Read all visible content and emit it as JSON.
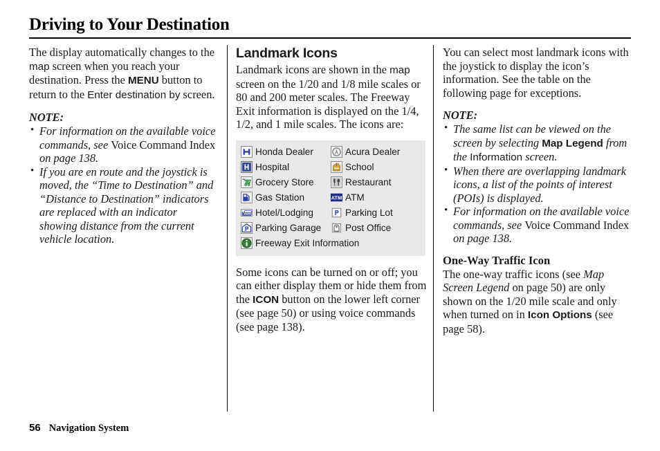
{
  "document": {
    "title": "Driving to Your Destination",
    "footer": {
      "page_number": "56",
      "section": "Navigation System"
    }
  },
  "colors": {
    "table_background": "#e9e9e9",
    "honda_blue": "#2a3fa8",
    "hospital_blue": "#2a3fa8",
    "grocery_green": "#1f7a33",
    "gas_blue": "#2a3fa8",
    "hotel_blue": "#3a4fb0",
    "parking_blue": "#2a3fa8",
    "atm_blue": "#23309a",
    "school_tan": "#d9a33c",
    "restaurant_gray": "#8c8c8c",
    "freeway_green": "#2e7d32",
    "acura_gray": "#9a9a9a",
    "postoffice_gray": "#7a7a7a",
    "text": "#1a1a1a"
  },
  "column_left": {
    "intro": {
      "s1": "The display automatically changes to the ",
      "screen_word_1": "map",
      "s2": " screen when you reach your destination. Press the ",
      "button_word": "MENU",
      "s3": " button to return to the ",
      "screen_word_2": "Enter destination by",
      "s4": " screen."
    },
    "note_label": "NOTE:",
    "notes": [
      {
        "a": "For information on the available voice commands, see ",
        "b": "Voice Command Index",
        "c": " on page 138."
      },
      {
        "a": "If you are en route and the joystick is moved, the “Time to Destination” and “Distance to Destination” indicators are replaced with an indicator showing distance from the current vehicle location.",
        "b": "",
        "c": ""
      }
    ]
  },
  "column_middle": {
    "heading": "Landmark Icons",
    "intro": {
      "s1": "Landmark icons are shown in the ",
      "screen_word": "map",
      "s2": " screen on the 1/20 and 1/8 mile scales or 80 and 200 meter scales. The Freeway Exit information is displayed on the 1/4, 1/2, and 1 mile scales. The icons are:"
    },
    "icon_table": {
      "rows": [
        [
          {
            "icon": "honda-dealer-icon",
            "label": "Honda Dealer"
          },
          {
            "icon": "acura-dealer-icon",
            "label": "Acura Dealer"
          }
        ],
        [
          {
            "icon": "hospital-icon",
            "label": "Hospital"
          },
          {
            "icon": "school-icon",
            "label": "School"
          }
        ],
        [
          {
            "icon": "grocery-store-icon",
            "label": "Grocery Store"
          },
          {
            "icon": "restaurant-icon",
            "label": "Restaurant"
          }
        ],
        [
          {
            "icon": "gas-station-icon",
            "label": "Gas Station"
          },
          {
            "icon": "atm-icon",
            "label": "ATM"
          }
        ],
        [
          {
            "icon": "hotel-lodging-icon",
            "label": "Hotel/Lodging"
          },
          {
            "icon": "parking-lot-icon",
            "label": "Parking Lot"
          }
        ],
        [
          {
            "icon": "parking-garage-icon",
            "label": "Parking Garage"
          },
          {
            "icon": "post-office-icon",
            "label": "Post Office"
          }
        ],
        [
          {
            "icon": "freeway-exit-information-icon",
            "label": "Freeway Exit Information"
          }
        ]
      ]
    },
    "outro": {
      "s1": "Some icons can be turned on or off; you can either display them or hide them from the ",
      "button_word": "ICON",
      "s2": " button on the lower left corner (see page 50) or using voice commands (see page 138)."
    }
  },
  "column_right": {
    "intro": "You can select most landmark icons with the joystick to display the icon’s information. See the table on the following page for exceptions.",
    "note_label": "NOTE:",
    "notes": [
      {
        "a": "The same list can be viewed on the screen by selecting ",
        "bold_screen": "Map Legend",
        "b": " from the ",
        "screen": "Information",
        "c": " screen."
      },
      {
        "a": "When there are overlapping landmark icons, a list of the points of interest (POIs) is displayed.",
        "bold_screen": "",
        "b": "",
        "screen": "",
        "c": ""
      },
      {
        "a": "For information on the available voice commands, see ",
        "bold_screen": "",
        "b": "",
        "screen": "Voice Command Index",
        "c": " on page 138."
      }
    ],
    "subheading": "One-Way Traffic Icon",
    "body": {
      "s1": "The one-way traffic icons (see ",
      "italic_ref": "Map Screen Legend",
      "s2": " on page 50) are only shown on the 1/20 mile scale and only when turned on in ",
      "bold_screen": "Icon Options",
      "s3": " (see page 58)."
    }
  }
}
